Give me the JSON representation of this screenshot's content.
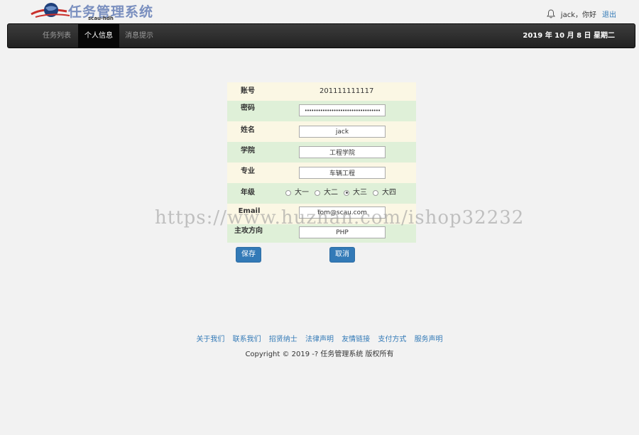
{
  "header": {
    "logo_title": "任务管理系统",
    "logo_sub": "scau-hdh",
    "greeting": "jack，你好",
    "logout": "退出"
  },
  "nav": {
    "items": [
      {
        "label": "任务列表"
      },
      {
        "label": "个人信息"
      },
      {
        "label": "消息提示"
      }
    ],
    "active_index": 1,
    "date": "2019 年 10 月 8 日 星期二"
  },
  "form": {
    "account_label": "账号",
    "account_value": "201111111117",
    "password_label": "密码",
    "password_value": "••••••••••••••••••••••••••••••••••",
    "name_label": "姓名",
    "name_value": "jack",
    "college_label": "学院",
    "college_value": "工程学院",
    "major_label": "专业",
    "major_value": "车辆工程",
    "grade_label": "年级",
    "grade_options": [
      "大一",
      "大二",
      "大三",
      "大四"
    ],
    "grade_selected": "大三",
    "email_label": "Email",
    "email_value": "tom@scau.com",
    "direction_label": "主攻方向",
    "direction_value": "PHP",
    "save_label": "保存",
    "cancel_label": "取消"
  },
  "footer": {
    "links": [
      "关于我们",
      "联系我们",
      "招贤纳士",
      "法律声明",
      "友情链接",
      "支付方式",
      "服务声明"
    ],
    "copyright": "Copyright © 2019 -? 任务管理系统 版权所有"
  },
  "watermark": "https://www.huzhan.com/ishop32232",
  "colors": {
    "accent": "#337ab7",
    "navbar": "#222222",
    "row_yellow": "#fbf7e4",
    "row_green": "#dff0d8"
  }
}
